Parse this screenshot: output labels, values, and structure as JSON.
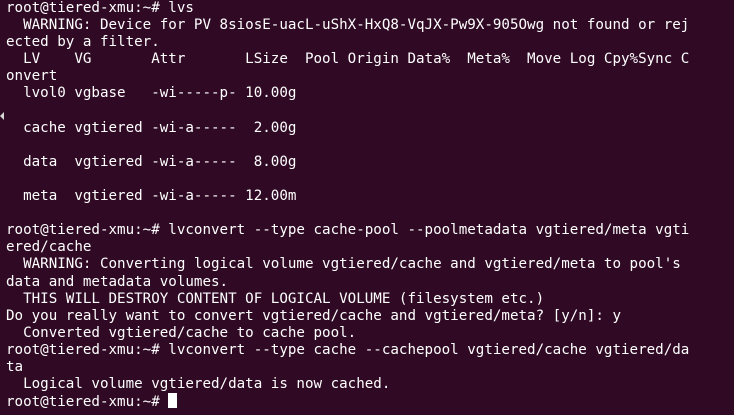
{
  "terminal": {
    "lines": [
      "root@tiered-xmu:~# lvs",
      "  WARNING: Device for PV 8siosE-uacL-uShX-HxQ8-VqJX-Pw9X-905Owg not found or rej",
      "ected by a filter.",
      "  LV    VG       Attr       LSize  Pool Origin Data%  Meta%  Move Log Cpy%Sync C",
      "onvert",
      "  lvol0 vgbase   -wi-----p- 10.00g",
      "",
      "  cache vgtiered -wi-a-----  2.00g",
      "",
      "  data  vgtiered -wi-a-----  8.00g",
      "",
      "  meta  vgtiered -wi-a----- 12.00m",
      "",
      "root@tiered-xmu:~# lvconvert --type cache-pool --poolmetadata vgtiered/meta vgti",
      "ered/cache",
      "  WARNING: Converting logical volume vgtiered/cache and vgtiered/meta to pool's",
      "data and metadata volumes.",
      "  THIS WILL DESTROY CONTENT OF LOGICAL VOLUME (filesystem etc.)",
      "Do you really want to convert vgtiered/cache and vgtiered/meta? [y/n]: y",
      "  Converted vgtiered/cache to cache pool.",
      "root@tiered-xmu:~# lvconvert --type cache --cachepool vgtiered/cache vgtiered/da",
      "ta",
      "  Logical volume vgtiered/data is now cached."
    ],
    "prompt": "root@tiered-xmu:~# "
  },
  "colors": {
    "background": "#300a24",
    "foreground": "#ffffff"
  }
}
